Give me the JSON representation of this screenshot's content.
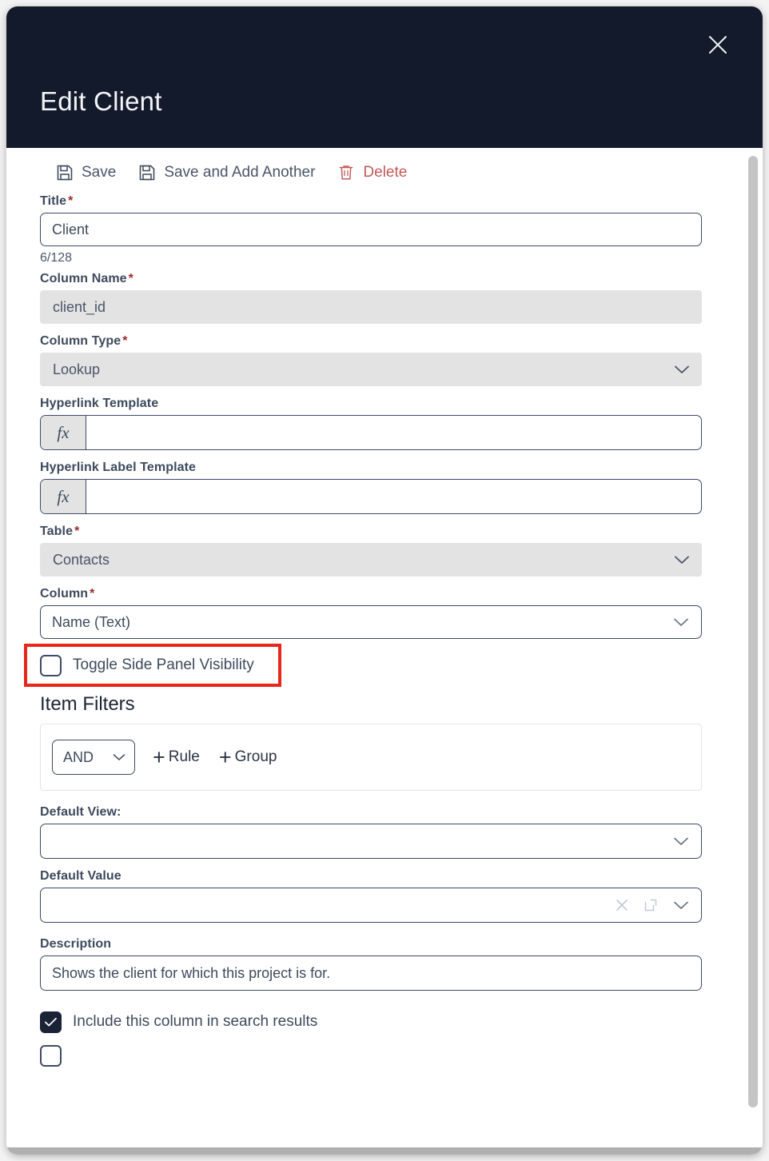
{
  "modal": {
    "title": "Edit Client",
    "close_icon": "close-icon"
  },
  "toolbar": {
    "save_label": "Save",
    "save_add_label": "Save and Add Another",
    "delete_label": "Delete",
    "delete_color": "#c25b5b"
  },
  "fields": {
    "title": {
      "label": "Title",
      "required": "*",
      "value": "Client",
      "counter": "6/128"
    },
    "column_name": {
      "label": "Column Name",
      "required": "*",
      "value": "client_id"
    },
    "column_type": {
      "label": "Column Type",
      "required": "*",
      "value": "Lookup"
    },
    "hyperlink_template": {
      "label": "Hyperlink Template",
      "prefix": "fx",
      "value": ""
    },
    "hyperlink_label_template": {
      "label": "Hyperlink Label Template",
      "prefix": "fx",
      "value": ""
    },
    "table": {
      "label": "Table",
      "required": "*",
      "value": "Contacts"
    },
    "column": {
      "label": "Column",
      "required": "*",
      "value": "Name (Text)"
    },
    "toggle_side_panel": {
      "label": "Toggle Side Panel Visibility",
      "checked": false
    },
    "default_view": {
      "label": "Default View:",
      "value": ""
    },
    "default_value": {
      "label": "Default Value",
      "value": ""
    },
    "description": {
      "label": "Description",
      "value": "Shows the client for which this project is for."
    },
    "include_in_search": {
      "label": "Include this column in search results",
      "checked": true
    }
  },
  "item_filters": {
    "heading": "Item Filters",
    "conjunction": "AND",
    "add_rule_label": "Rule",
    "add_group_label": "Group",
    "plus": "+"
  },
  "colors": {
    "header_bg": "#131a2b",
    "highlight": "#e8271a",
    "field_border": "#3d4a66",
    "disabled_bg": "#e3e3e3",
    "checked_bg": "#1a2236"
  }
}
